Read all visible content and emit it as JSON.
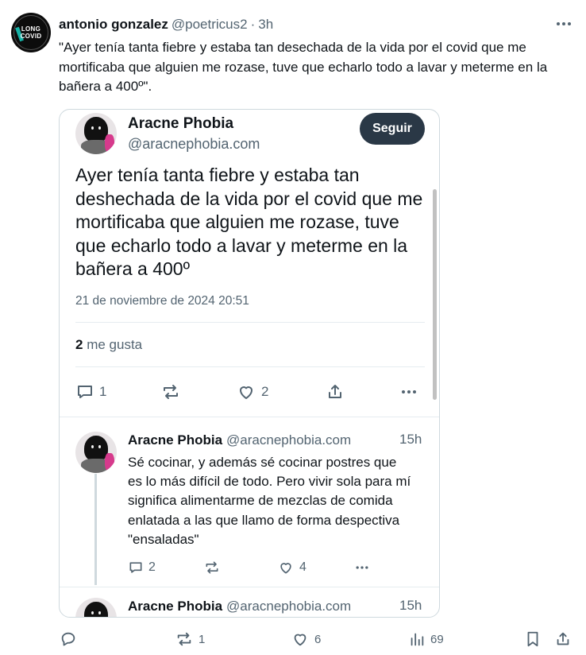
{
  "post": {
    "author_name": "antonio gonzalez",
    "author_handle": "@poetricus2",
    "separator": "·",
    "time": "3h",
    "avatar_text_top": "LONG",
    "avatar_text_bottom": "COVID",
    "text": "\"Ayer tenía tanta fiebre y estaba tan desechada de la vida por el covid que me mortificaba que alguien me rozase, tuve que echarlo todo a lavar y meterme en la bañera a 400º\".",
    "actions": {
      "reply_count": "",
      "repost_count": "1",
      "like_count": "6",
      "views_count": "69"
    }
  },
  "embed": {
    "author_name": "Aracne Phobia",
    "author_handle": "@aracnephobia.com",
    "follow_label": "Seguir",
    "text": "Ayer tenía tanta fiebre y estaba tan deshechada de la vida por el covid que me mortificaba que alguien me rozase, tuve que echarlo todo a lavar y meterme en la bañera a 400º",
    "date": "21 de noviembre de 2024 20:51",
    "likes_number": "2",
    "likes_label": "me gusta",
    "actions": {
      "reply_count": "1",
      "like_count": "2"
    },
    "replies": [
      {
        "author_name": "Aracne Phobia",
        "author_handle": "@aracnephobia.com",
        "time": "15h",
        "text": "Sé cocinar, y además sé cocinar postres que es lo más difícil de todo. Pero vivir sola para mí significa alimentarme de mezclas de comida enlatada a las que llamo de forma despectiva \"ensaladas\"",
        "reply_count": "2",
        "like_count": "4"
      },
      {
        "author_name": "Aracne Phobia",
        "author_handle": "@aracnephobia.com",
        "time": "15h"
      }
    ]
  },
  "colors": {
    "text_primary": "#0f1419",
    "text_secondary": "#536471",
    "follow_button": "#2a3846",
    "border": "#cfd9de"
  }
}
